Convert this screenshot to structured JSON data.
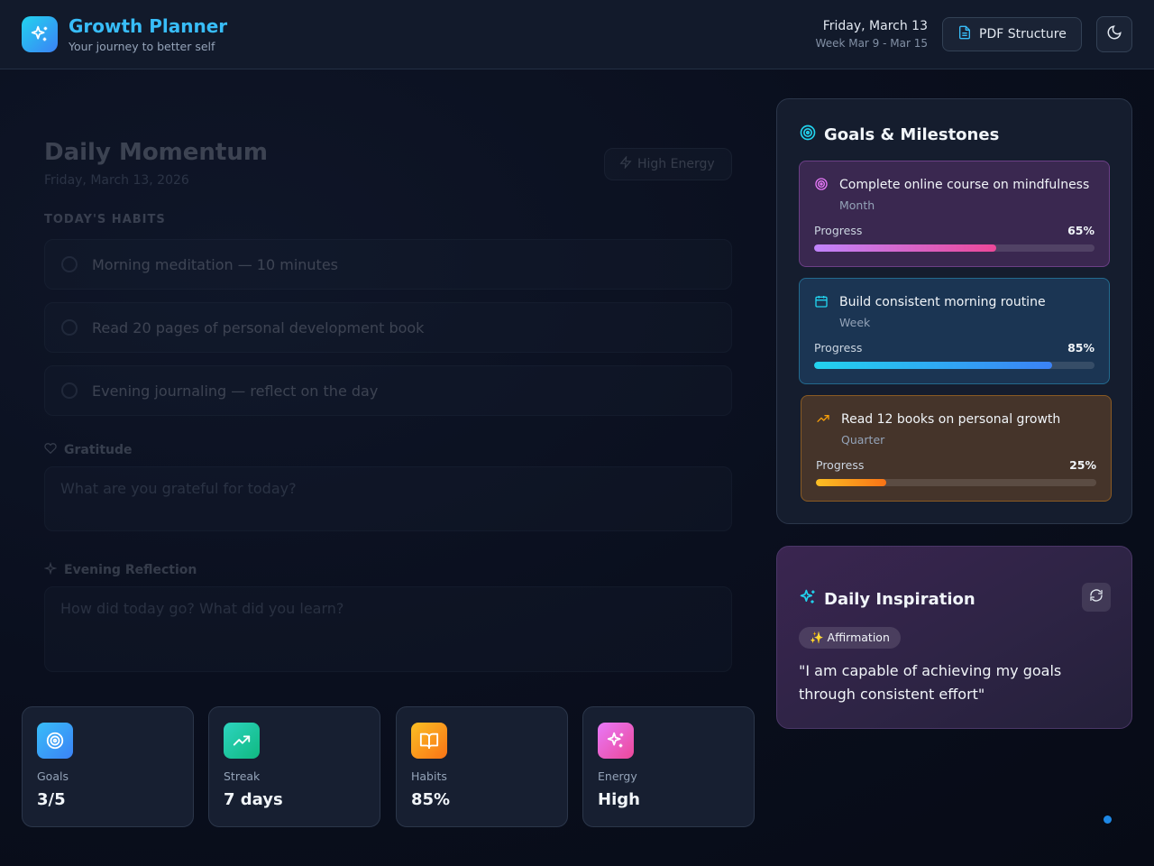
{
  "header": {
    "title": "Growth Planner",
    "subtitle": "Your journey to better self",
    "date": "Friday, March 13",
    "week": "Week Mar 9 - Mar 15",
    "pdf_button": "PDF Structure",
    "theme_icon": "moon-icon"
  },
  "momentum": {
    "title": "Daily Momentum",
    "date": "Friday, March 13, 2026",
    "energy": "High Energy",
    "habits_heading": "TODAY'S HABITS",
    "habits": [
      "Morning meditation — 10 minutes",
      "Read 20 pages of personal development book",
      "Evening journaling — reflect on the day"
    ],
    "gratitude_label": "Gratitude",
    "gratitude_placeholder": "What are you grateful for today?",
    "reflection_label": "Evening Reflection",
    "reflection_placeholder": "How did today go? What did you learn?"
  },
  "stats": [
    {
      "label": "Goals",
      "value": "3/5",
      "icon": "target-icon",
      "color": "#38bdf8"
    },
    {
      "label": "Streak",
      "value": "7 days",
      "icon": "trending-up-icon",
      "color": "#2dd4bf"
    },
    {
      "label": "Habits",
      "value": "85%",
      "icon": "book-icon",
      "color": "#f59e0b"
    },
    {
      "label": "Energy",
      "value": "High",
      "icon": "sparkles-icon",
      "color": "#e879f9"
    }
  ],
  "goals": {
    "title": "Goals & Milestones",
    "progress_label": "Progress",
    "items": [
      {
        "name": "Complete online course on mindfulness",
        "period": "Month",
        "percent": "65%",
        "progress": 0.65,
        "icon": "target-icon"
      },
      {
        "name": "Build consistent morning routine",
        "period": "Week",
        "percent": "85%",
        "progress": 0.85,
        "icon": "calendar-icon"
      },
      {
        "name": "Read 12 books on personal growth",
        "period": "Quarter",
        "percent": "25%",
        "progress": 0.25,
        "icon": "trending-up-icon"
      }
    ]
  },
  "inspiration": {
    "title": "Daily Inspiration",
    "chip": "✨ Affirmation",
    "quote": "\"I am capable of achieving my goals through consistent effort\""
  }
}
